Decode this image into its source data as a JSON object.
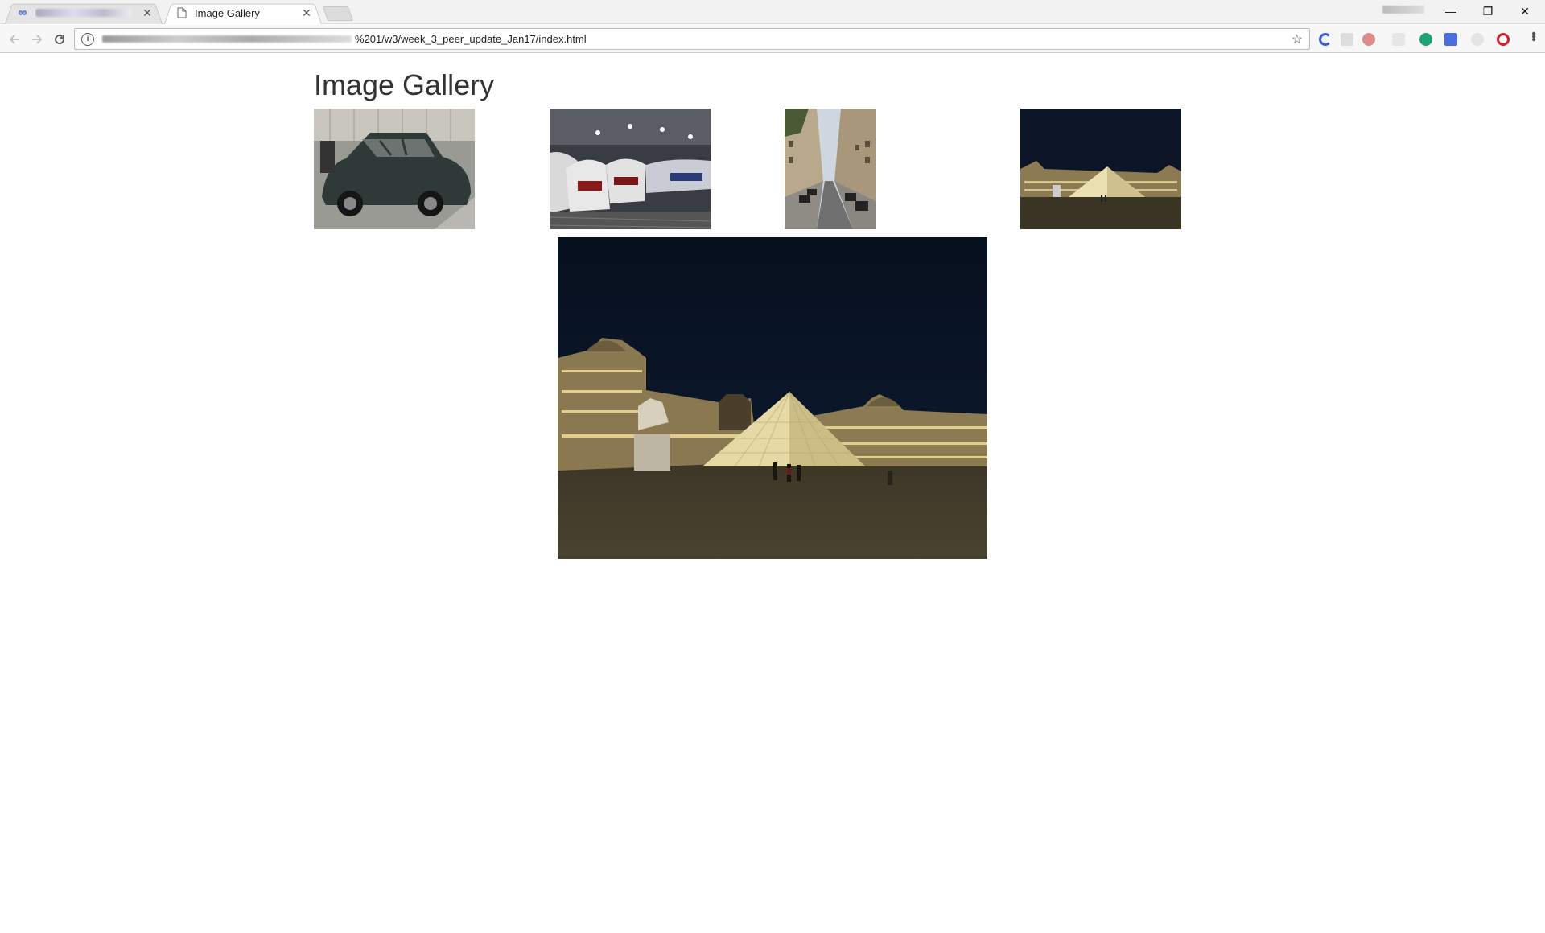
{
  "browser": {
    "tabs": [
      {
        "label": ""
      },
      {
        "label": "Image Gallery",
        "active": true
      }
    ],
    "address": {
      "url_visible": "%201/w3/week_3_peer_update_Jan17/index.html"
    },
    "window_controls": {
      "minimize": "—",
      "restore": "❐",
      "close": "✕"
    }
  },
  "page": {
    "title": "Image Gallery",
    "thumbnails": [
      {
        "subject": "vintage car"
      },
      {
        "subject": "high-speed trains"
      },
      {
        "subject": "narrow street"
      },
      {
        "subject": "louvre pyramid at night"
      }
    ],
    "large_image": {
      "subject": "louvre pyramid at night"
    }
  },
  "icons": {
    "back": "back-arrow-icon",
    "forward": "forward-arrow-icon",
    "reload": "reload-icon",
    "info": "info-icon",
    "star": "bookmark-star-icon",
    "menu": "kebab-menu-icon"
  }
}
